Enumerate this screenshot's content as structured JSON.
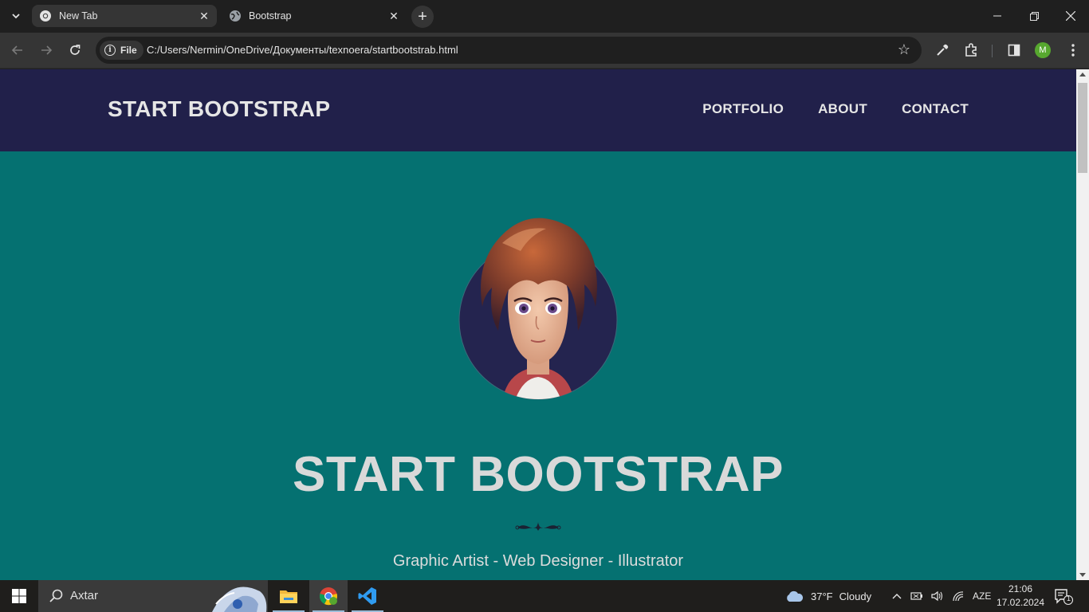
{
  "browser": {
    "tabs": [
      {
        "title": "New Tab",
        "active": true,
        "icon": "chrome-icon"
      },
      {
        "title": "Bootstrap",
        "active": false,
        "icon": "globe-icon"
      }
    ],
    "address": {
      "scheme_chip": "File",
      "url": "C:/Users/Nermin/OneDrive/Документы/texnoera/startbootstrab.html"
    },
    "profile_initial": "M"
  },
  "page": {
    "brand": "START BOOTSTRAP",
    "nav": [
      "PORTFOLIO",
      "ABOUT",
      "CONTACT"
    ],
    "hero_title": "START BOOTSTRAP",
    "subtitle": "Graphic Artist - Web Designer - Illustrator",
    "colors": {
      "navbar_bg": "#21204a",
      "hero_bg": "#057171",
      "text": "#d9d9d9"
    }
  },
  "taskbar": {
    "search_placeholder": "Axtar",
    "weather_temp": "37°F",
    "weather_desc": "Cloudy",
    "language": "AZE",
    "time": "21:06",
    "date": "17.02.2024",
    "notification_count": "1"
  }
}
